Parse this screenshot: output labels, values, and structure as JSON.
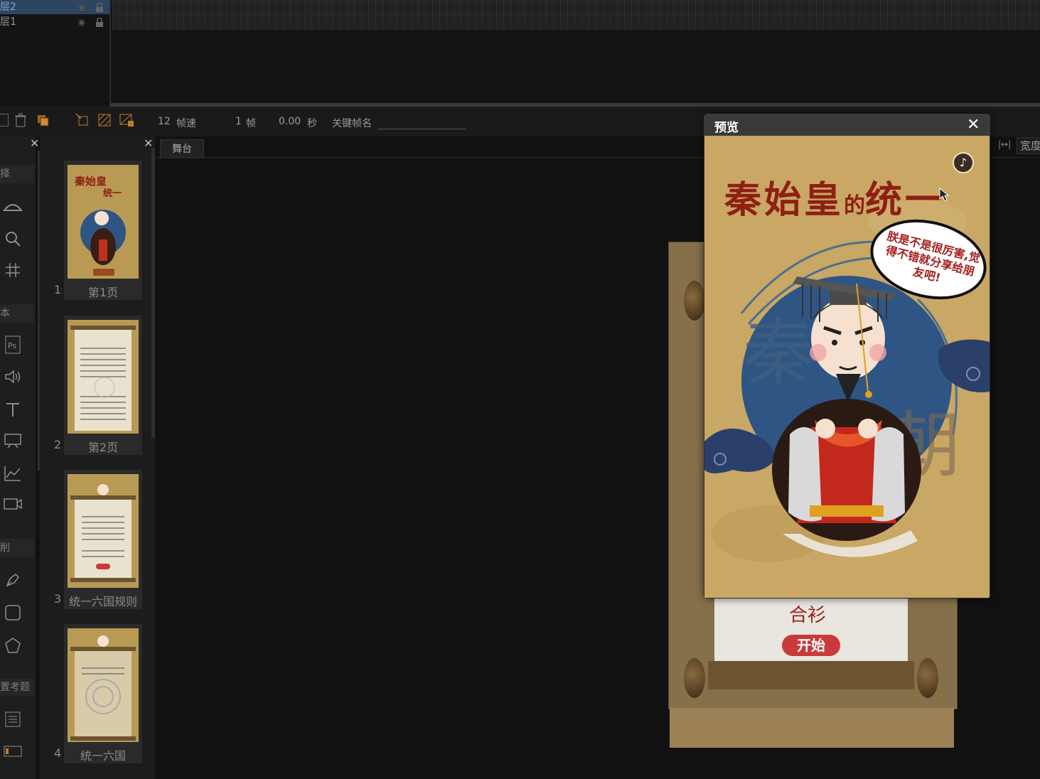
{
  "timeline": {
    "layers": [
      {
        "name": "层2",
        "selected": true
      },
      {
        "name": "层1",
        "selected": false
      }
    ]
  },
  "toolbar": {
    "fps_value": "12",
    "fps_label": "帧速",
    "frame_value": "1",
    "frame_label": "帧",
    "time_value": "0.00",
    "time_label": "秒",
    "keyframe_label": "关键帧名",
    "keyframe_value": ""
  },
  "toolbox": {
    "sections": [
      "择",
      "本",
      "削",
      "置考题"
    ]
  },
  "pages": [
    {
      "num": "1",
      "label": "第1页"
    },
    {
      "num": "2",
      "label": "第2页"
    },
    {
      "num": "3",
      "label": "统一六国规则"
    },
    {
      "num": "4",
      "label": "统一六国"
    }
  ],
  "stage": {
    "tab": "舞台",
    "width_label": "宽度",
    "behind_start_button": "开始",
    "behind_handwriting": "合衫"
  },
  "preview": {
    "title": "预览",
    "close": "✕",
    "game_title_part1": "秦始皇",
    "game_title_small": "的",
    "game_title_part2": "统一",
    "bubble_text": "朕是不是很厉害,觉得不错就分享给朋友吧!",
    "music_icon": "♪",
    "bg_watermark": "秦朝"
  },
  "colors": {
    "title_red": "#8e1f13",
    "parchment": "#c9a764",
    "circle_blue": "#2f5584",
    "start_red": "#c93a3a"
  }
}
